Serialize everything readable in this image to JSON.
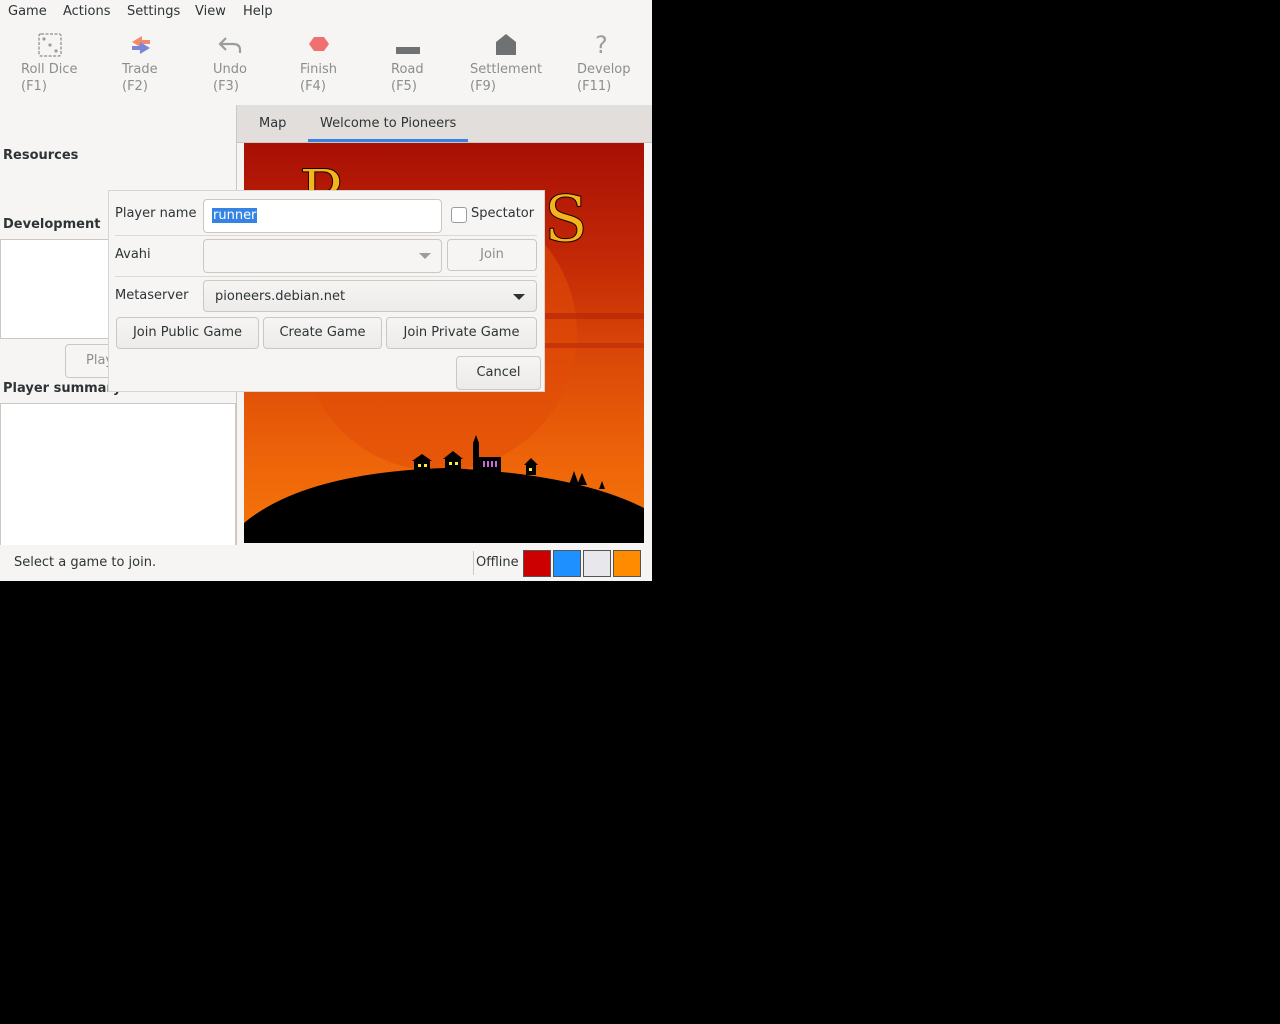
{
  "menubar": {
    "items": [
      "Game",
      "Actions",
      "Settings",
      "View",
      "Help"
    ]
  },
  "toolbar": {
    "items": [
      {
        "label": "Roll Dice",
        "key": "(F1)",
        "icon": "dice-icon"
      },
      {
        "label": "Trade",
        "key": "(F2)",
        "icon": "trade-arrows-icon"
      },
      {
        "label": "Undo",
        "key": "(F3)",
        "icon": "undo-arrow-icon"
      },
      {
        "label": "Finish",
        "key": "(F4)",
        "icon": "finish-octagon-icon"
      },
      {
        "label": "Road",
        "key": "(F5)",
        "icon": "road-icon"
      },
      {
        "label": "Settlement",
        "key": "(F9)",
        "icon": "settlement-house-icon"
      },
      {
        "label": "Develop",
        "key": "(F11)",
        "icon": "question-mark-icon"
      }
    ]
  },
  "left_panel": {
    "resources_title": "Resources",
    "development_title": "Development",
    "play_button_partial": "Play",
    "player_summary_title": "Player summary"
  },
  "notebook": {
    "tabs": [
      "Map",
      "Welcome to Pioneers"
    ],
    "active_tab": "Welcome to Pioneers"
  },
  "status": {
    "message": "Select a game to join.",
    "connection": "Offline",
    "player_colors": [
      "#cc0000",
      "#1e90ff",
      "#e8e8ec",
      "#ff8c00"
    ]
  },
  "dialog": {
    "player_name_label": "Player name",
    "player_name_value": "runner",
    "spectator_label": "Spectator",
    "spectator_checked": false,
    "avahi_label": "Avahi",
    "avahi_value": "",
    "join_label": "Join",
    "metaserver_label": "Metaserver",
    "metaserver_value": "pioneers.debian.net",
    "join_public_label": "Join Public Game",
    "create_game_label": "Create Game",
    "join_private_label": "Join Private Game",
    "cancel_label": "Cancel"
  },
  "colors": {
    "accent": "#3584e4",
    "selection": "#3584e4"
  }
}
